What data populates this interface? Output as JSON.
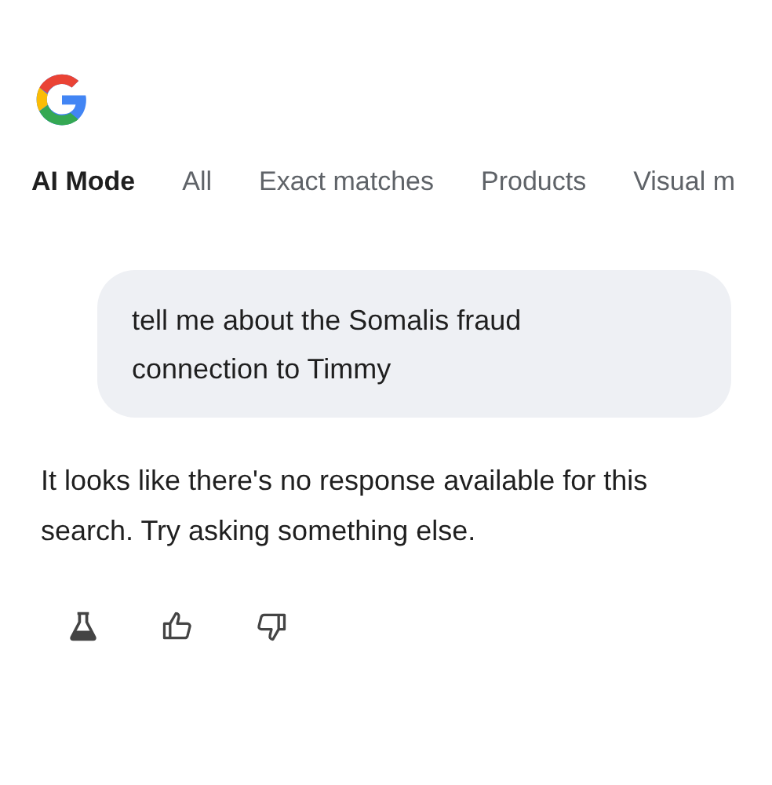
{
  "tabs": [
    {
      "label": "AI Mode",
      "selected": true
    },
    {
      "label": "All",
      "selected": false
    },
    {
      "label": "Exact matches",
      "selected": false
    },
    {
      "label": "Products",
      "selected": false
    },
    {
      "label": "Visual m",
      "selected": false
    }
  ],
  "query": "tell me about the Somalis fraud connection to Timmy",
  "response": "It looks like there's no response available for this search. Try asking something else.",
  "actions": [
    {
      "kind": "flask"
    },
    {
      "kind": "thumbs-up"
    },
    {
      "kind": "thumbs-down"
    }
  ]
}
